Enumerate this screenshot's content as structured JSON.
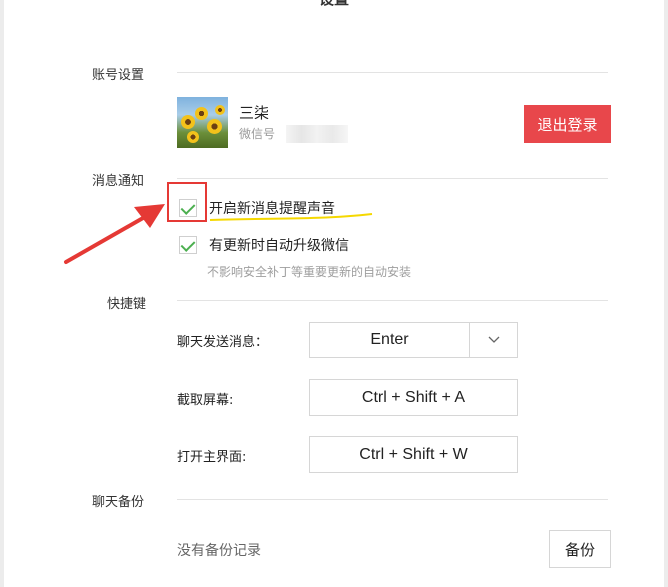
{
  "window": {
    "title": "设置"
  },
  "account": {
    "section_label": "账号设置",
    "nickname": "三柒",
    "wxid_label": "微信号",
    "logout_label": "退出登录",
    "logout_color": "#e8474b"
  },
  "notify": {
    "section_label": "消息通知",
    "options": [
      {
        "label": "开启新消息提醒声音",
        "checked": true
      },
      {
        "label": "有更新时自动升级微信",
        "checked": true
      }
    ],
    "update_hint": "不影响安全补丁等重要更新的自动安装"
  },
  "shortcuts": {
    "section_label": "快捷键",
    "items": [
      {
        "label": "聊天发送消息：",
        "value": "Enter"
      },
      {
        "label": "截取屏幕:",
        "value": "Ctrl + Shift + A"
      },
      {
        "label": "打开主界面:",
        "value": "Ctrl + Shift + W"
      }
    ]
  },
  "backup": {
    "section_label": "聊天备份",
    "empty_text": "没有备份记录",
    "button_label": "备份"
  },
  "annotation": {
    "box_color": "#e53935",
    "arrow_color": "#e53935",
    "underline_color": "#f5d800"
  },
  "check_color": "#4caf50"
}
